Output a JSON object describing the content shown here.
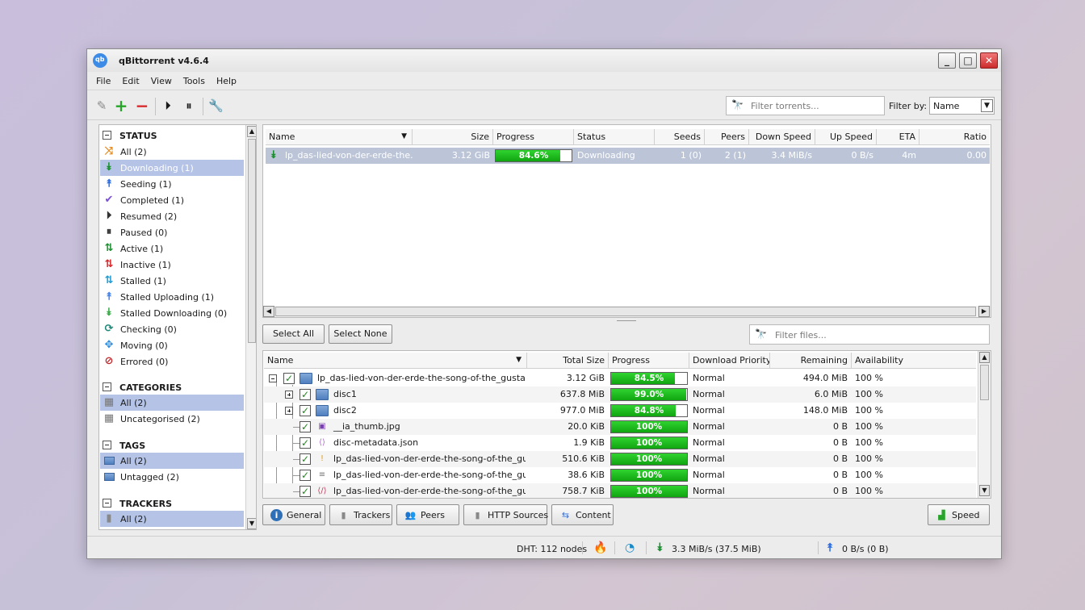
{
  "window": {
    "title": "qBittorrent v4.6.4"
  },
  "menu": [
    "File",
    "Edit",
    "View",
    "Tools",
    "Help"
  ],
  "toolbar": {
    "filter_placeholder": "Filter torrents...",
    "filter_by_label": "Filter by:",
    "filter_by_value": "Name"
  },
  "sidebar": {
    "status_title": "STATUS",
    "status_items": [
      {
        "label": "All (2)",
        "icon": "shuffle-icon",
        "color": "#e58a1f"
      },
      {
        "label": "Downloading (1)",
        "icon": "double-chevron-down-icon",
        "color": "#1b8f2f"
      },
      {
        "label": "Seeding (1)",
        "icon": "double-chevron-up-icon",
        "color": "#2f6fe0"
      },
      {
        "label": "Completed (1)",
        "icon": "checkmark-icon",
        "color": "#7b4fd8"
      },
      {
        "label": "Resumed (2)",
        "icon": "play-circle-icon",
        "color": "#333333"
      },
      {
        "label": "Paused (0)",
        "icon": "pause-circle-icon",
        "color": "#333333"
      },
      {
        "label": "Active (1)",
        "icon": "arrows-updown-icon",
        "color": "#1b8f2f"
      },
      {
        "label": "Inactive (1)",
        "icon": "arrows-updown-red-icon",
        "color": "#d6262a"
      },
      {
        "label": "Stalled (1)",
        "icon": "arrows-updown-blue-icon",
        "color": "#1f9bd1"
      },
      {
        "label": "Stalled Uploading (1)",
        "icon": "double-chevron-up-light-icon",
        "color": "#4a86e8"
      },
      {
        "label": "Stalled Downloading (0)",
        "icon": "double-chevron-down-light-icon",
        "color": "#3caa4a"
      },
      {
        "label": "Checking (0)",
        "icon": "refresh-icon",
        "color": "#1d8a7a"
      },
      {
        "label": "Moving (0)",
        "icon": "move-icon",
        "color": "#2f8ee0"
      },
      {
        "label": "Errored (0)",
        "icon": "error-icon",
        "color": "#c2262a"
      }
    ],
    "categories_title": "CATEGORIES",
    "category_items": [
      {
        "label": "All (2)"
      },
      {
        "label": "Uncategorised (2)"
      }
    ],
    "tags_title": "TAGS",
    "tag_items": [
      {
        "label": "All (2)"
      },
      {
        "label": "Untagged (2)"
      }
    ],
    "trackers_title": "TRACKERS",
    "tracker_items": [
      {
        "label": "All (2)"
      }
    ]
  },
  "torrents": {
    "columns": [
      "Name",
      "Size",
      "Progress",
      "Status",
      "Seeds",
      "Peers",
      "Down Speed",
      "Up Speed",
      "ETA",
      "Ratio"
    ],
    "rows": [
      {
        "name": "lp_das-lied-von-der-erde-the...",
        "size": "3.12 GiB",
        "progress": 0.846,
        "progress_text": "84.6%",
        "status": "Downloading",
        "seeds": "1 (0)",
        "peers": "2 (1)",
        "down_speed": "3.4 MiB/s",
        "up_speed": "0 B/s",
        "eta": "4m",
        "ratio": "0.00"
      }
    ]
  },
  "content": {
    "select_all": "Select All",
    "select_none": "Select None",
    "filter_placeholder": "Filter files...",
    "columns": [
      "Name",
      "Total Size",
      "Progress",
      "Download Priority",
      "Remaining",
      "Availability"
    ],
    "rows": [
      {
        "name": "lp_das-lied-von-der-erde-the-song-of-the_gustav...",
        "size": "3.12 GiB",
        "progress": 0.845,
        "progress_text": "84.5%",
        "priority": "Normal",
        "remaining": "494.0 MiB",
        "availability": "100 %",
        "type": "folder"
      },
      {
        "name": "disc1",
        "size": "637.8 MiB",
        "progress": 0.99,
        "progress_text": "99.0%",
        "priority": "Normal",
        "remaining": "6.0 MiB",
        "availability": "100 %",
        "type": "folder"
      },
      {
        "name": "disc2",
        "size": "977.0 MiB",
        "progress": 0.848,
        "progress_text": "84.8%",
        "priority": "Normal",
        "remaining": "148.0 MiB",
        "availability": "100 %",
        "type": "folder"
      },
      {
        "name": "__ia_thumb.jpg",
        "size": "20.0 KiB",
        "progress": 1.0,
        "progress_text": "100%",
        "priority": "Normal",
        "remaining": "0 B",
        "availability": "100 %",
        "type": "image"
      },
      {
        "name": "disc-metadata.json",
        "size": "1.9 KiB",
        "progress": 1.0,
        "progress_text": "100%",
        "priority": "Normal",
        "remaining": "0 B",
        "availability": "100 %",
        "type": "json"
      },
      {
        "name": "lp_das-lied-von-der-erde-the-song-of-the_gu...",
        "size": "510.6 KiB",
        "progress": 1.0,
        "progress_text": "100%",
        "priority": "Normal",
        "remaining": "0 B",
        "availability": "100 %",
        "type": "text"
      },
      {
        "name": "lp_das-lied-von-der-erde-the-song-of-the_gu...",
        "size": "38.6 KiB",
        "progress": 1.0,
        "progress_text": "100%",
        "priority": "Normal",
        "remaining": "0 B",
        "availability": "100 %",
        "type": "doc"
      },
      {
        "name": "lp_das-lied-von-der-erde-the-song-of-the_gu...",
        "size": "758.7 KiB",
        "progress": 1.0,
        "progress_text": "100%",
        "priority": "Normal",
        "remaining": "0 B",
        "availability": "100 %",
        "type": "xml"
      }
    ]
  },
  "tabs": [
    "General",
    "Trackers",
    "Peers",
    "HTTP Sources",
    "Content"
  ],
  "speed_button": "Speed",
  "statusbar": {
    "dht": "DHT: 112 nodes",
    "download": "3.3 MiB/s (37.5 MiB)",
    "upload": "0 B/s (0 B)"
  }
}
